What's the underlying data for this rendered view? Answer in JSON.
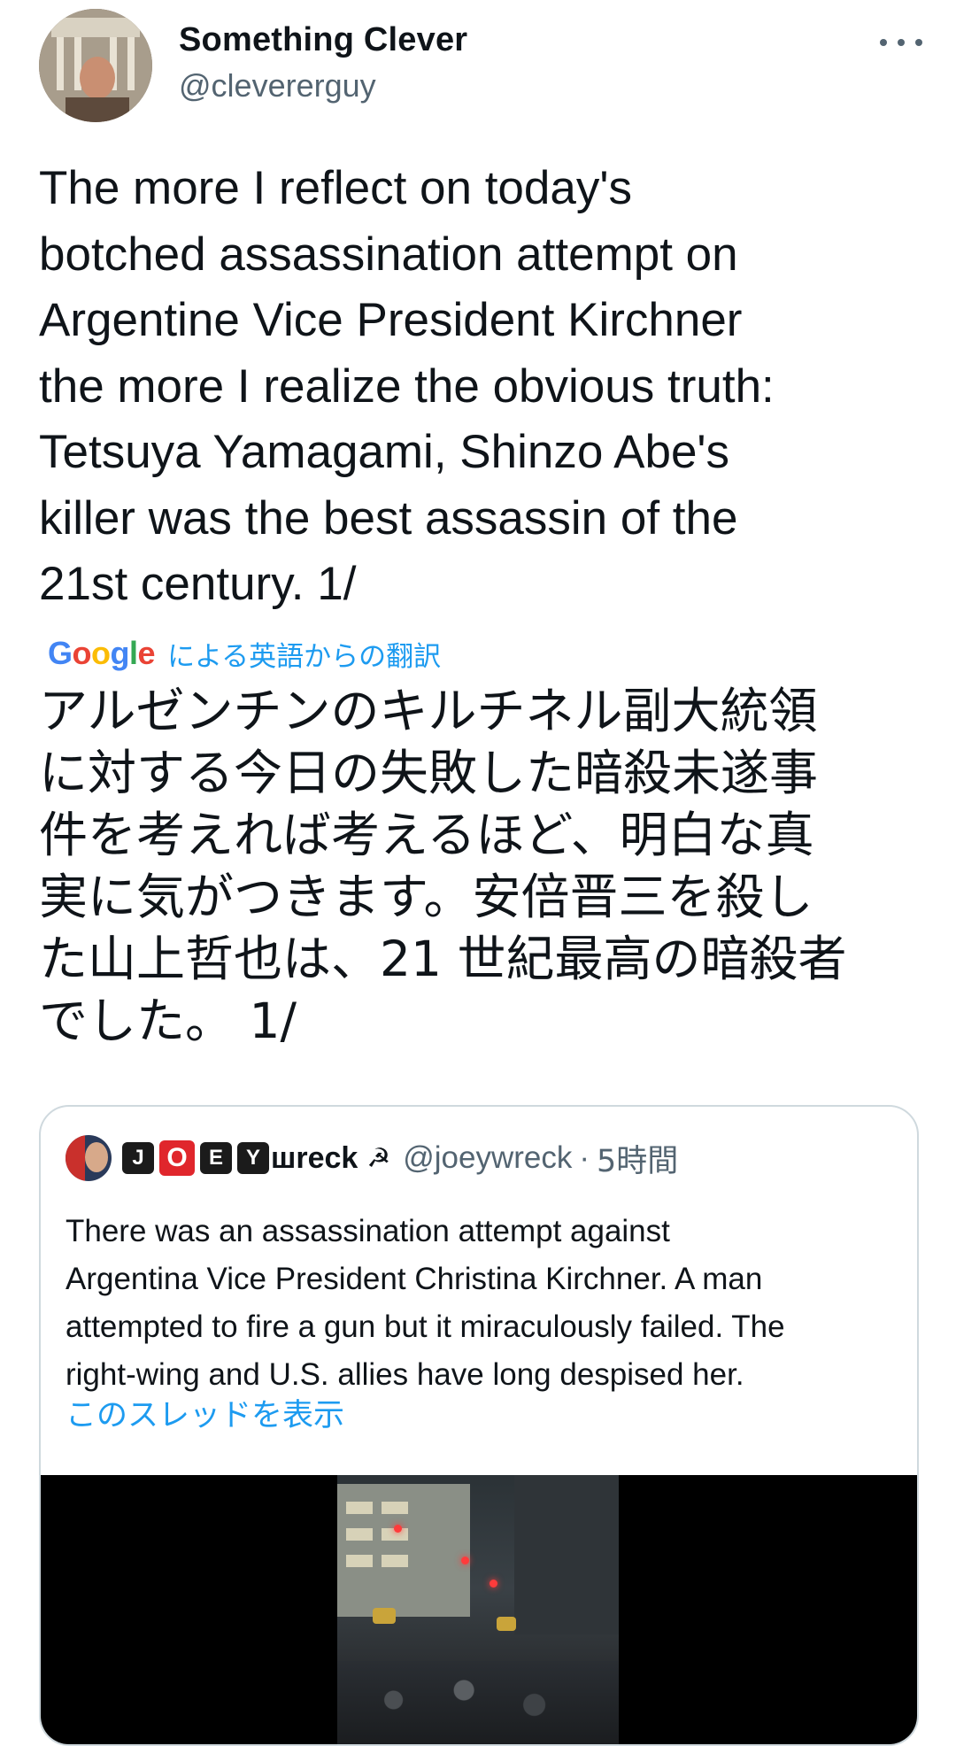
{
  "tweet": {
    "author_name": "Something Clever",
    "author_handle": "@clevererguy",
    "text": "The more I reflect on today's\nbotched assassination attempt on\nArgentine Vice President Kirchner\nthe more I realize the obvious truth:\nTetsuya Yamagami, Shinzo Abe's\nkiller was the best assassin of the\n21st century. 1/",
    "translation_provider": "Google",
    "translation_label": "による英語からの翻訳",
    "translated_text": "アルゼンチンのキルチネル副大統領\nに対する今日の失敗した暗殺未遂事\n件を考えれば考えるほど、明白な真\n実に気がつきます。安倍晋三を殺し\nた山上哲也は、21 世紀最高の暗殺者\nでした。 1/"
  },
  "quote": {
    "name_letters": [
      "J",
      "O",
      "E",
      "Y"
    ],
    "name_rest": "шreck",
    "name_emoji": "☭",
    "handle": "@joeywreck",
    "separator": "·",
    "time": "5時間",
    "text": "There was an assassination attempt against\nArgentina Vice President Christina Kirchner. A man\nattempted to fire a gun but it miraculously failed. The\nright-wing and U.S. allies have long despised her.",
    "show_thread": "このスレッドを表示"
  },
  "colors": {
    "text": "#0f1419",
    "secondary": "#536471",
    "link": "#1d9bf0",
    "border": "#cfd9de"
  },
  "icons": [
    "more-icon",
    "sickle-icon"
  ]
}
